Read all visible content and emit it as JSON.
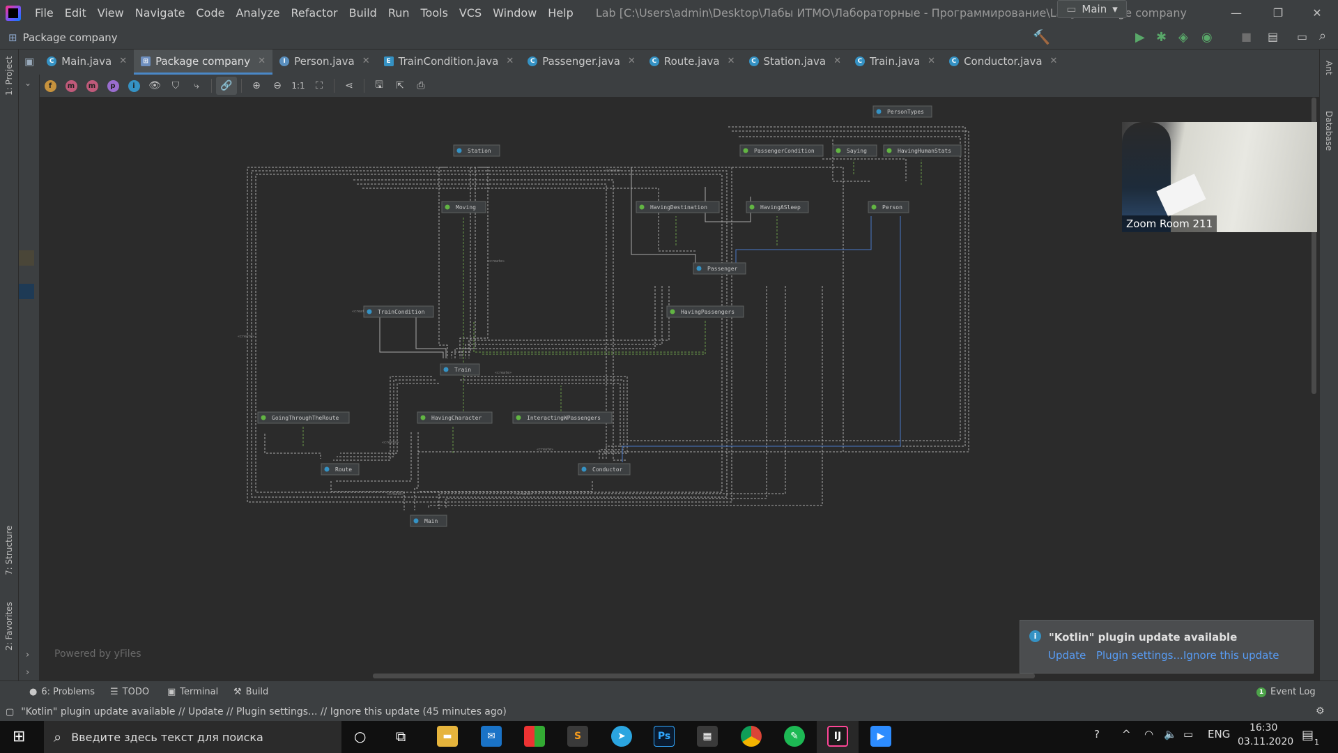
{
  "menu": [
    "File",
    "Edit",
    "View",
    "Navigate",
    "Code",
    "Analyze",
    "Refactor",
    "Build",
    "Run",
    "Tools",
    "VCS",
    "Window",
    "Help"
  ],
  "window_title": "Lab [C:\\Users\\admin\\Desktop\\Лабы ИТМО\\Лабораторные - Программирование\\Lab] - Package company",
  "nav": {
    "project": "Package company",
    "run_config": "Main"
  },
  "tabs": [
    {
      "label": "Main.java",
      "icon": "class-icon"
    },
    {
      "label": "Package company",
      "icon": "diagram-icon",
      "active": true
    },
    {
      "label": "Person.java",
      "icon": "interface-icon"
    },
    {
      "label": "TrainCondition.java",
      "icon": "enum-icon"
    },
    {
      "label": "Passenger.java",
      "icon": "class-icon"
    },
    {
      "label": "Route.java",
      "icon": "class-icon"
    },
    {
      "label": "Station.java",
      "icon": "class-icon"
    },
    {
      "label": "Train.java",
      "icon": "class-icon"
    },
    {
      "label": "Conductor.java",
      "icon": "class-icon"
    }
  ],
  "left_stripe": {
    "project": "1: Project",
    "structure": "7: Structure",
    "favorites": "2: Favorites"
  },
  "right_stripe": {
    "ant": "Ant",
    "database": "Database"
  },
  "diagram": {
    "nodes": [
      "PersonTypes",
      "Station",
      "PassengerCondition",
      "Saying",
      "HavingHumanStats",
      "Moving",
      "HavingDestination",
      "HavingASleep",
      "Person",
      "Passenger",
      "TrainCondition",
      "HavingPassengers",
      "Train",
      "GoingThroughTheRoute",
      "HavingCharacter",
      "InteractingWPassengers",
      "Route",
      "Conductor",
      "Main"
    ],
    "edge_label": "«create»",
    "multiplicity": "1"
  },
  "powered_by": "Powered by yFiles",
  "zoom_overlay": {
    "label": "Zoom Room 211"
  },
  "notification": {
    "title": "\"Kotlin\" plugin update available",
    "links": [
      "Update",
      "Plugin settings...",
      "Ignore this update"
    ]
  },
  "bottom_tools": [
    {
      "label": "6: Problems",
      "icon": "problems-icon"
    },
    {
      "label": "TODO",
      "icon": "todo-icon"
    },
    {
      "label": "Terminal",
      "icon": "terminal-icon"
    },
    {
      "label": "Build",
      "icon": "build-icon"
    }
  ],
  "event_log": {
    "label": "Event Log",
    "count": "1"
  },
  "status": "\"Kotlin\" plugin update available // Update // Plugin settings... // Ignore this update (45 minutes ago)",
  "taskbar": {
    "search_placeholder": "Введите здесь текст для поиска",
    "lang": "ENG",
    "time": "16:30",
    "date": "03.11.2020",
    "notif_count": "1"
  }
}
